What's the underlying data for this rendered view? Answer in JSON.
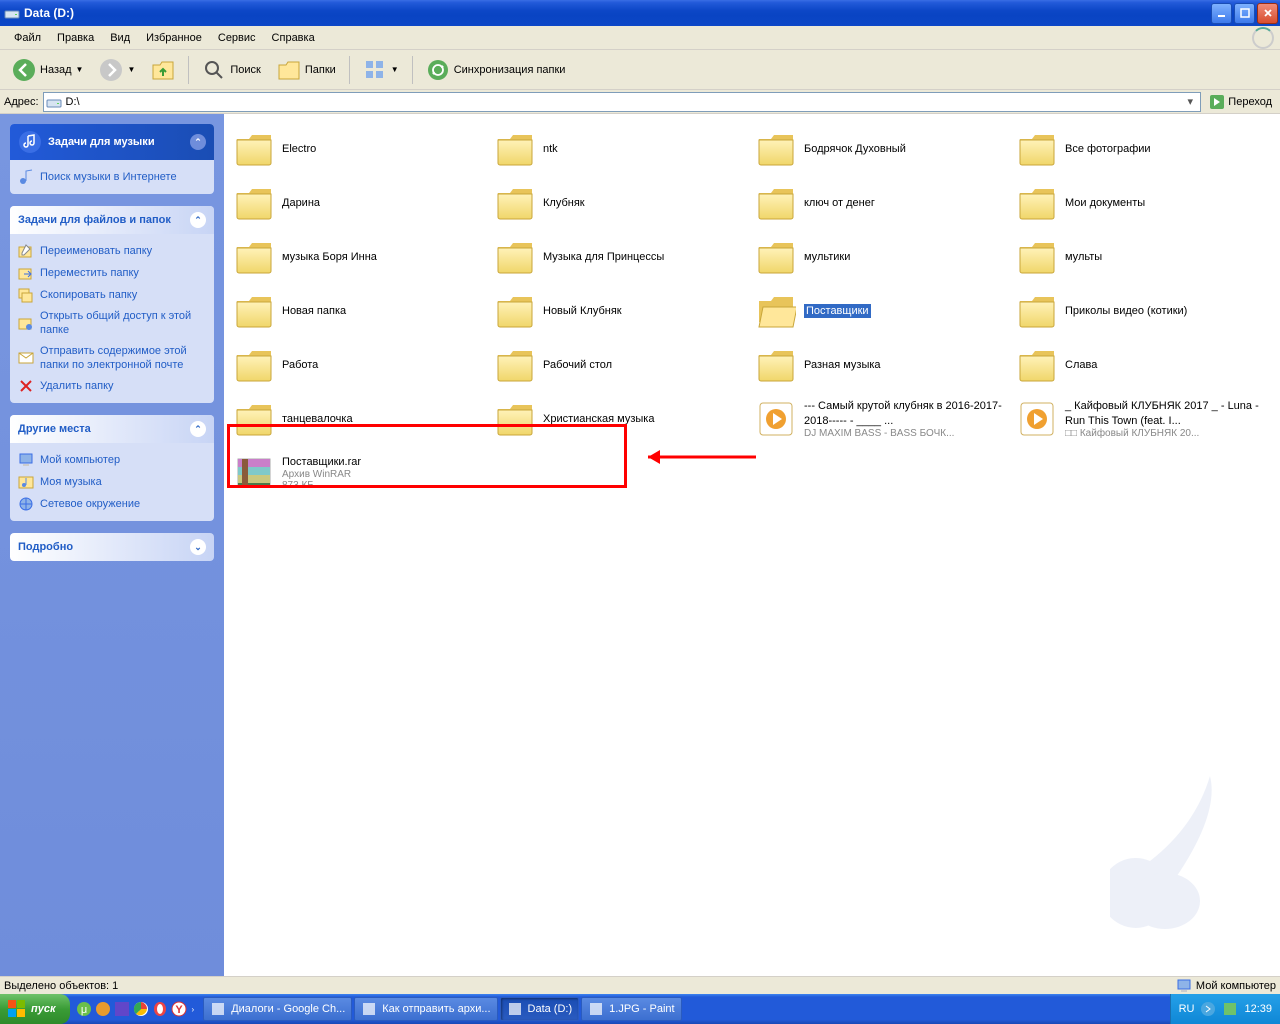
{
  "window": {
    "title": "Data (D:)"
  },
  "menu": {
    "file": "Файл",
    "edit": "Правка",
    "view": "Вид",
    "favorites": "Избранное",
    "tools": "Сервис",
    "help": "Справка"
  },
  "toolbar": {
    "back": "Назад",
    "search": "Поиск",
    "folders": "Папки",
    "sync": "Синхронизация папки"
  },
  "address": {
    "label": "Адрес:",
    "value": "D:\\",
    "go": "Переход"
  },
  "sidebar": {
    "music": {
      "title": "Задачи для музыки",
      "search": "Поиск музыки в Интернете"
    },
    "files": {
      "title": "Задачи для файлов и папок",
      "rename": "Переименовать папку",
      "move": "Переместить папку",
      "copy": "Скопировать папку",
      "share": "Открыть общий доступ к этой папке",
      "email": "Отправить содержимое этой папки по электронной почте",
      "delete": "Удалить папку"
    },
    "places": {
      "title": "Другие места",
      "mycomputer": "Мой компьютер",
      "mymusic": "Моя музыка",
      "network": "Сетевое окружение"
    },
    "details": {
      "title": "Подробно"
    }
  },
  "items": [
    {
      "type": "folder",
      "label": "Electro"
    },
    {
      "type": "folder",
      "label": "ntk"
    },
    {
      "type": "folder",
      "label": "Бодрячок Духовный"
    },
    {
      "type": "folder",
      "label": "Все фотографии"
    },
    {
      "type": "folder",
      "label": "Дарина"
    },
    {
      "type": "folder",
      "label": "Клубняк"
    },
    {
      "type": "folder",
      "label": "ключ от денег"
    },
    {
      "type": "folder",
      "label": "Мои документы"
    },
    {
      "type": "folder",
      "label": "музыка Боря Инна"
    },
    {
      "type": "folder",
      "label": "Музыка для Принцессы"
    },
    {
      "type": "folder",
      "label": "мультики"
    },
    {
      "type": "folder",
      "label": "мульты"
    },
    {
      "type": "folder",
      "label": "Новая папка"
    },
    {
      "type": "folder",
      "label": "Новый Клубняк"
    },
    {
      "type": "folder",
      "label": "Поставщики",
      "selected": true
    },
    {
      "type": "folder",
      "label": "Приколы видео (котики)"
    },
    {
      "type": "folder",
      "label": "Работа"
    },
    {
      "type": "folder",
      "label": "Рабочий стол"
    },
    {
      "type": "folder",
      "label": "Разная музыка"
    },
    {
      "type": "folder",
      "label": "Слава"
    },
    {
      "type": "folder",
      "label": "танцевалочка"
    },
    {
      "type": "folder",
      "label": "Христианская музыка"
    },
    {
      "type": "audio",
      "label": "--- Самый крутой клубняк в 2016-2017-2018----- - ____ ...",
      "sub": "DJ MAXIM BASS - BASS БОЧК..."
    },
    {
      "type": "audio",
      "label": "_ Кайфовый КЛУБНЯК 2017 _ - Luna - Run This Town (feat. I...",
      "sub": "□□ Кайфовый КЛУБНЯК 20..."
    },
    {
      "type": "rar",
      "label": "Поставщики.rar",
      "sub": "Архив WinRAR",
      "sub2": "873 КБ"
    }
  ],
  "status": {
    "left": "Выделено объектов: 1",
    "right": "Мой компьютер"
  },
  "taskbar": {
    "start": "пуск",
    "tasks": [
      {
        "label": "Диалоги - Google Ch..."
      },
      {
        "label": "Как отправить архи..."
      },
      {
        "label": "Data (D:)",
        "active": true
      },
      {
        "label": "1.JPG - Paint"
      }
    ],
    "lang": "RU",
    "clock": "12:39"
  }
}
